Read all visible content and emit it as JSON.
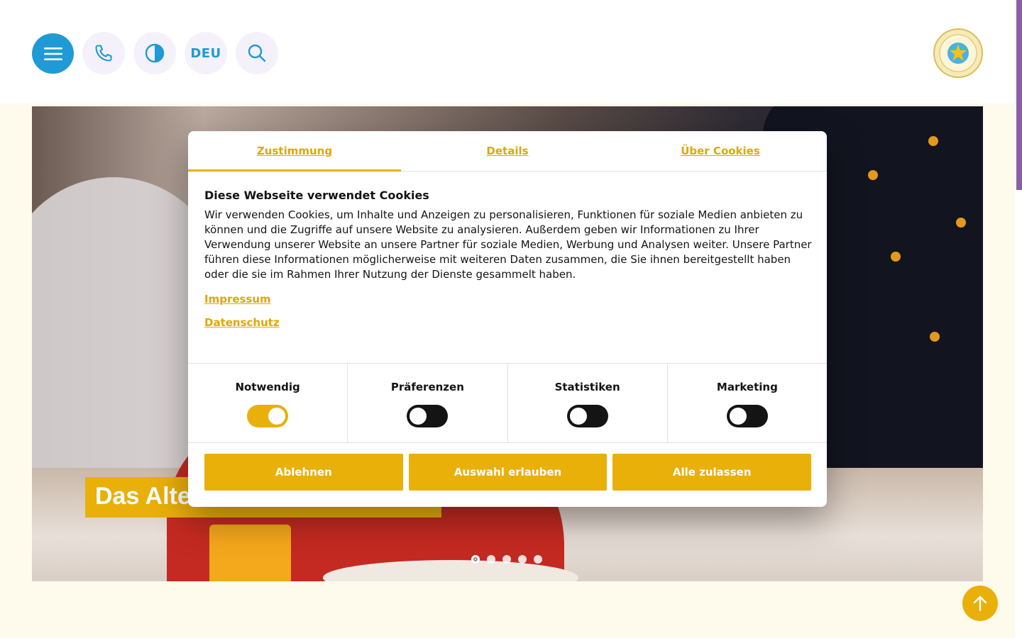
{
  "header": {
    "menu_icon": "hamburger-menu-icon",
    "phone_icon": "phone-icon",
    "contrast_icon": "contrast-icon",
    "language": "DEU",
    "search_icon": "search-icon",
    "logo_icon": "altenzentrum-logo-icon"
  },
  "hero": {
    "caption": "Das Alte",
    "slides": 5,
    "active_slide": 1
  },
  "cookie_dialog": {
    "tabs": [
      {
        "label": "Zustimmung"
      },
      {
        "label": "Details"
      },
      {
        "label": "Über Cookies"
      }
    ],
    "title": "Diese Webseite verwendet Cookies",
    "body": "Wir verwenden Cookies, um Inhalte und Anzeigen zu personalisieren, Funktionen für soziale Medien anbieten zu können und die Zugriffe auf unsere Website zu analysieren. Außerdem geben wir Informationen zu Ihrer Verwendung unserer Website an unsere Partner für soziale Medien, Werbung und Analysen weiter. Unsere Partner führen diese Informationen möglicherweise mit weiteren Daten zusammen, die Sie ihnen bereitgestellt haben oder die sie im Rahmen Ihrer Nutzung der Dienste gesammelt haben.",
    "links": [
      {
        "label": "Impressum"
      },
      {
        "label": "Datenschutz"
      }
    ],
    "categories": [
      {
        "label": "Notwendig",
        "enabled": true
      },
      {
        "label": "Präferenzen",
        "enabled": false
      },
      {
        "label": "Statistiken",
        "enabled": false
      },
      {
        "label": "Marketing",
        "enabled": false
      }
    ],
    "buttons": {
      "reject": "Ablehnen",
      "allow_selection": "Auswahl erlauben",
      "allow_all": "Alle zulassen"
    }
  },
  "scroll_top_icon": "arrow-up-icon",
  "colors": {
    "accent_yellow": "#e9b00a",
    "accent_blue": "#1f9ad6",
    "page_bg": "#fefaec"
  }
}
